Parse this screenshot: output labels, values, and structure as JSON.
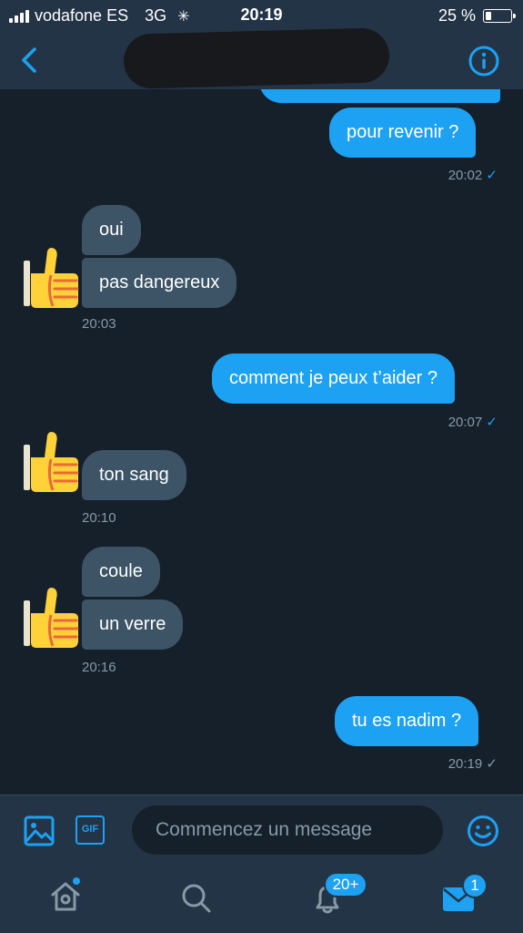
{
  "status_bar": {
    "carrier": "vodafone ES",
    "network": "3G",
    "time": "20:19",
    "battery": "25 %"
  },
  "messages": {
    "m1": "pour revenir ?",
    "t1": "20:02",
    "m2": "oui",
    "m3": "pas dangereux",
    "t2": "20:03",
    "m4": "comment je peux t’aider ?",
    "t3": "20:07",
    "m5": "ton sang",
    "t4": "20:10",
    "m6": "coule",
    "m7": "un verre",
    "t5": "20:16",
    "m8": "tu es nadim ?",
    "t6": "20:19"
  },
  "composer": {
    "gif_label": "GIF",
    "placeholder": "Commencez un message"
  },
  "tabbar": {
    "notifications_badge": "20+",
    "messages_badge": "1"
  },
  "colors": {
    "accent": "#1da1f2",
    "background": "#15202b",
    "bar": "#243447",
    "incoming_bubble": "#3d5466"
  },
  "icons": [
    "back-chevron-icon",
    "info-icon",
    "image-icon",
    "gif-icon",
    "emoji-icon",
    "home-icon",
    "search-icon",
    "bell-icon",
    "mail-icon",
    "thumbs-up-avatar"
  ]
}
